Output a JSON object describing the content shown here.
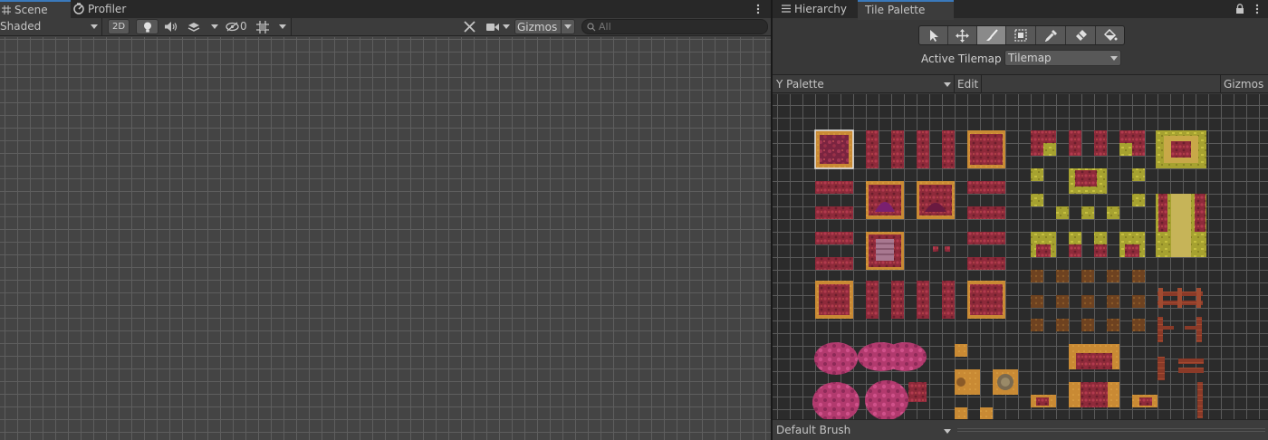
{
  "scene_window": {
    "tabs": [
      {
        "label": "Scene",
        "icon": "grid-icon",
        "active": true
      },
      {
        "label": "Profiler",
        "icon": "profiler-icon",
        "active": false
      }
    ],
    "toolbar": {
      "shading_mode": "Shaded",
      "mode_2d_label": "2D",
      "hidden_count": "0",
      "gizmos_label": "Gizmos",
      "search_placeholder": "All"
    }
  },
  "palette_window": {
    "tabs": [
      {
        "label": "Hierarchy",
        "icon": "list-icon",
        "active": false
      },
      {
        "label": "Tile Palette",
        "active": true
      }
    ],
    "tools": [
      {
        "name": "select",
        "icon": "select-arrow-icon"
      },
      {
        "name": "move",
        "icon": "move-icon"
      },
      {
        "name": "paint",
        "icon": "brush-icon",
        "selected": true
      },
      {
        "name": "box-fill",
        "icon": "box-fill-icon"
      },
      {
        "name": "pick",
        "icon": "eyedropper-icon"
      },
      {
        "name": "erase",
        "icon": "eraser-icon"
      },
      {
        "name": "fill",
        "icon": "paint-bucket-icon"
      }
    ],
    "active_tilemap_label": "Active Tilemap",
    "active_tilemap_value": "Tilemap",
    "palette_name": "Y Palette",
    "edit_label": "Edit",
    "gizmos_label": "Gizmos",
    "brush_name": "Default Brush"
  },
  "colors": {
    "panel_bg": "#383838",
    "toolbar_bg": "#3c3c3c",
    "grid_line": "#5e5e5e",
    "accent": "#3a79bb",
    "tile_crimson": "#8e2a3a",
    "tile_ochre": "#c98a34",
    "tile_olive": "#a6a230",
    "tile_pink": "#b23a6e",
    "tile_wood": "#8a3a28"
  }
}
